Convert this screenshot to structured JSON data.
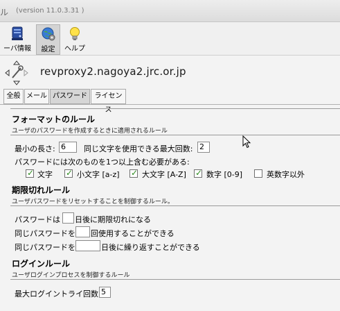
{
  "window": {
    "title_fragment": "ル",
    "version": "(version 11.0.3.31 )"
  },
  "toolbar": {
    "items": [
      {
        "label": "ーバ情報",
        "icon": "server-icon"
      },
      {
        "label": "設定",
        "icon": "settings-globe-icon",
        "active": true
      },
      {
        "label": "ヘルプ",
        "icon": "lightbulb-icon"
      }
    ]
  },
  "host": {
    "name": "revproxy2.nagoya2.jrc.or.jp"
  },
  "tabs": [
    {
      "label": "全般"
    },
    {
      "label": "メール"
    },
    {
      "label": "パスワード",
      "active": true
    },
    {
      "label": "ライセンス"
    }
  ],
  "format_rules": {
    "title": "フォーマットのルール",
    "description": "ユーザのパスワードを作成するときに適用されるルール",
    "min_length_label": "最小の長さ:",
    "min_length_value": "6",
    "max_repeat_label": "同じ文字を使用できる最大回数:",
    "max_repeat_value": "2",
    "requirement_label": "パスワードには次のものを1つ以上含む必要がある:",
    "checkboxes": [
      {
        "label": "文字",
        "checked": true
      },
      {
        "label": "小文字 [a-z]",
        "checked": true
      },
      {
        "label": "大文字 [A-Z]",
        "checked": true
      },
      {
        "label": "数字 [0-9]",
        "checked": true
      },
      {
        "label": "英数字以外",
        "checked": false
      }
    ]
  },
  "expiry_rules": {
    "title": "期限切れルール",
    "description": "ユーザパスワードをリセットすることを制御するルール。",
    "row1_pre": "パスワードは",
    "row1_value": "",
    "row1_post": "日後に期限切れになる",
    "row2_pre": "同じパスワードを",
    "row2_value": "",
    "row2_post": "回使用することができる",
    "row3_pre": "同じパスワードを",
    "row3_value": "",
    "row3_post": "日後に繰り返すことができる"
  },
  "login_rules": {
    "title": "ログインルール",
    "description": "ユーザログインプロセスを制御するルール",
    "max_attempts_label": "最大ログイントライ回数:",
    "max_attempts_value": "5"
  },
  "colors": {
    "check_green": "#2d8a1e",
    "active_tab": "#d6d6d6"
  }
}
